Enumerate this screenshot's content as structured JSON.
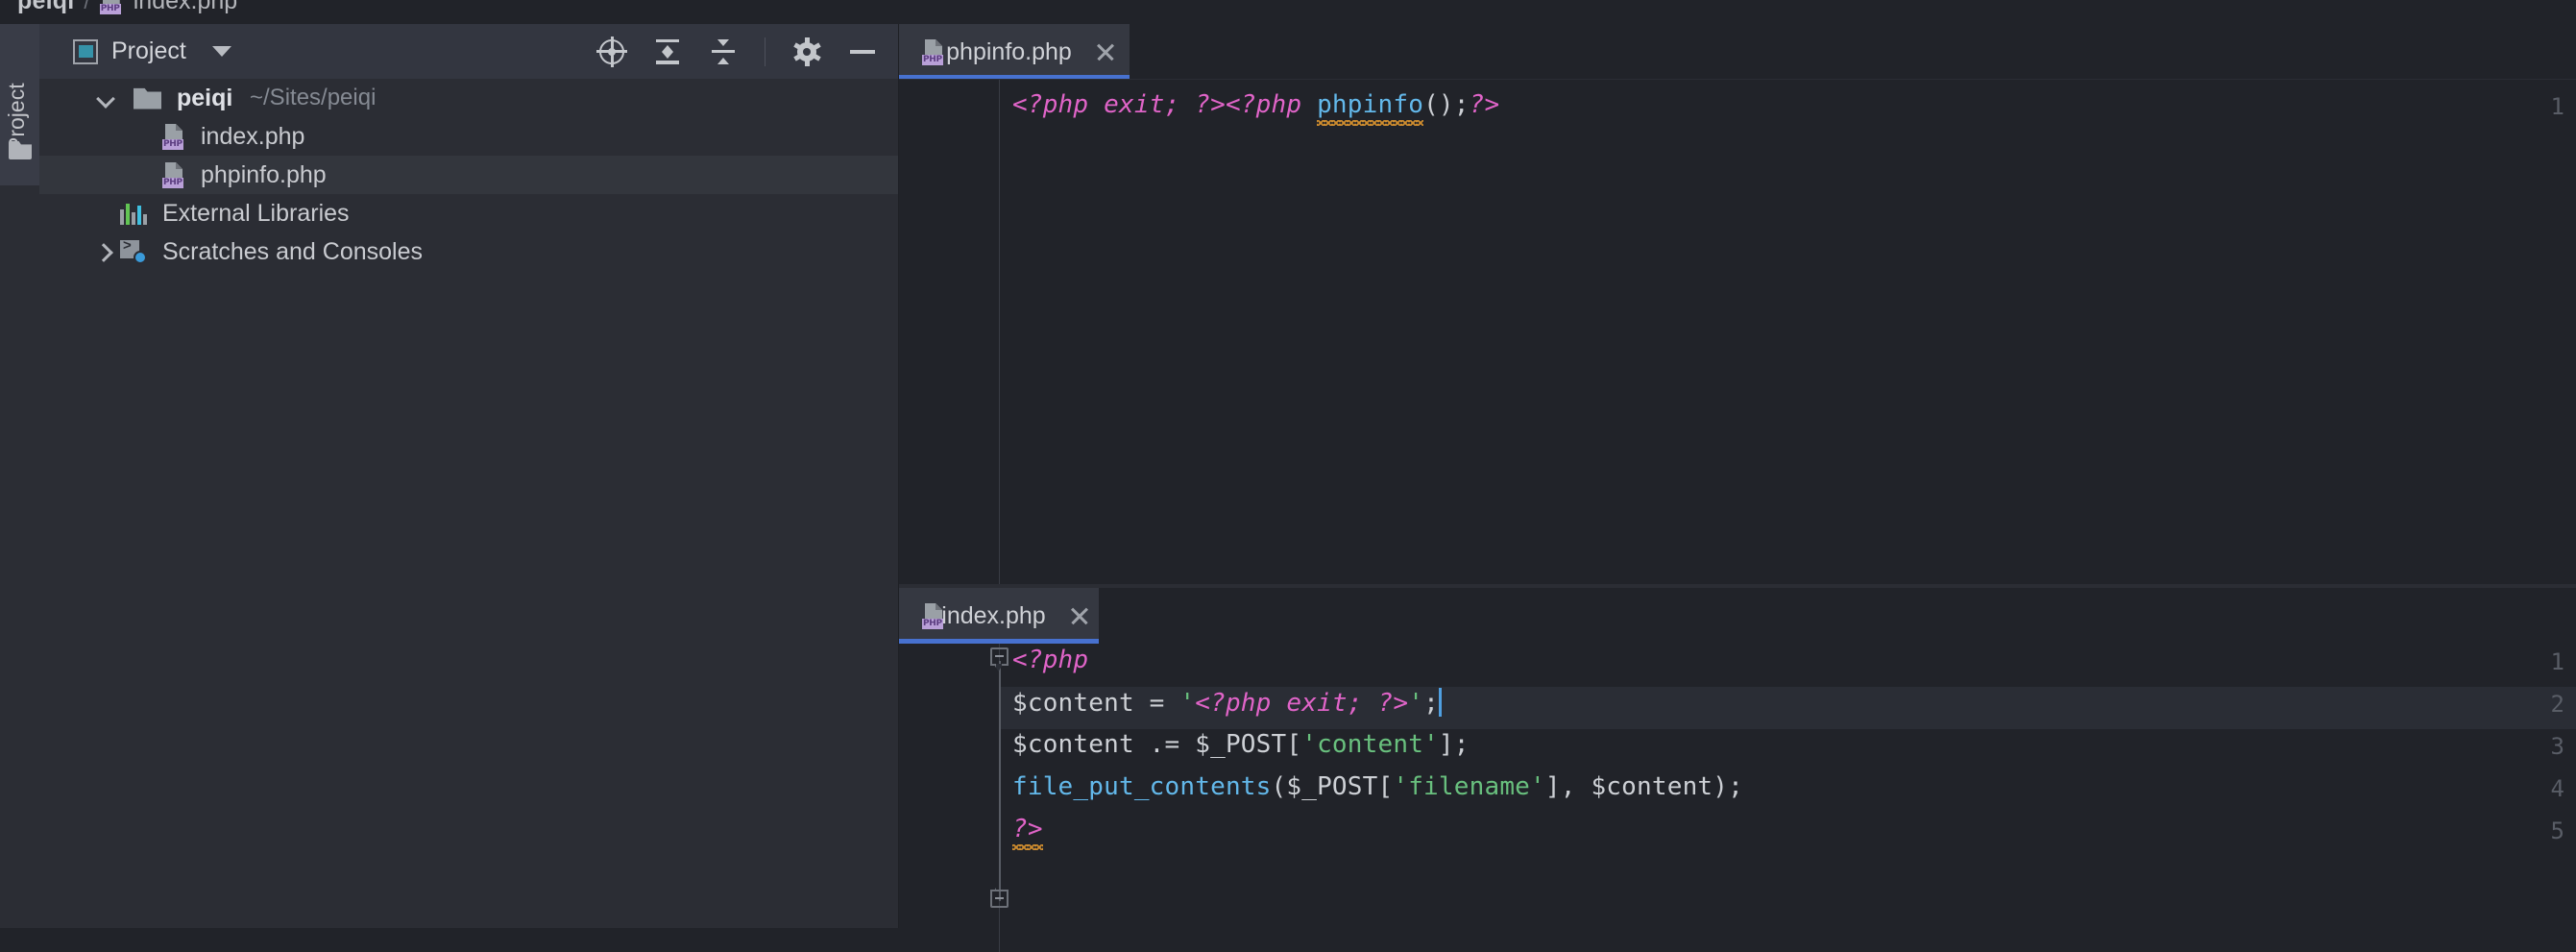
{
  "breadcrumb": {
    "project": "peiqi",
    "separator": "/",
    "file": "index.php",
    "file_icon": "php-file-icon"
  },
  "side_tool_strip": {
    "tab_label": "Project",
    "folder_icon": "folder-icon"
  },
  "project_panel": {
    "title": "Project",
    "panel_icon": "project-view-icon",
    "dropdown_icon": "chevron-down-icon",
    "toolbar": [
      {
        "name": "locate-in-tree-button",
        "icon": "target-icon"
      },
      {
        "name": "expand-all-button",
        "icon": "expand-all-icon"
      },
      {
        "name": "collapse-all-button",
        "icon": "collapse-all-icon"
      },
      {
        "name": "panel-settings-button",
        "icon": "gear-icon"
      },
      {
        "name": "hide-panel-button",
        "icon": "minimize-icon"
      }
    ],
    "tree": [
      {
        "label": "peiqi",
        "secondary": "~/Sites/peiqi",
        "icon": "folder-icon",
        "expander": "chevron-down-icon",
        "indent": 58,
        "bold": true,
        "selected": false
      },
      {
        "label": "index.php",
        "secondary": "",
        "icon": "php-file-icon",
        "expander": "",
        "indent": 122,
        "bold": false,
        "selected": false
      },
      {
        "label": "phpinfo.php",
        "secondary": "",
        "icon": "php-file-icon",
        "expander": "",
        "indent": 122,
        "bold": false,
        "selected": true
      },
      {
        "label": "External Libraries",
        "secondary": "",
        "icon": "library-icon",
        "expander": "",
        "indent": 83,
        "bold": false,
        "selected": false
      },
      {
        "label": "Scratches and Consoles",
        "secondary": "",
        "icon": "scratches-icon",
        "expander": "chevron-right-icon",
        "indent": 83,
        "bold": false,
        "selected": false
      }
    ]
  },
  "editors": {
    "top": {
      "tab": {
        "label": "phpinfo.php",
        "icon": "php-file-icon",
        "close_icon": "close-icon",
        "active": true
      },
      "lines": [
        {
          "number": "1",
          "tokens": [
            {
              "text": "<?php exit; ?><?php ",
              "type": "tag"
            },
            {
              "text": "phpinfo",
              "type": "func-squiggle"
            },
            {
              "text": "();",
              "type": "plain"
            },
            {
              "text": "?>",
              "type": "tag"
            }
          ]
        }
      ]
    },
    "bottom": {
      "tab": {
        "label": "index.php",
        "icon": "php-file-icon",
        "close_icon": "close-icon",
        "active": true
      },
      "lines": [
        {
          "number": "1",
          "fold": "fold-start",
          "tokens": [
            {
              "text": "<?php",
              "type": "tag"
            }
          ]
        },
        {
          "number": "2",
          "current": true,
          "tokens": [
            {
              "text": "$content = ",
              "type": "plain"
            },
            {
              "text": "'",
              "type": "str"
            },
            {
              "text": "<?php exit; ?>",
              "type": "tag-in-string"
            },
            {
              "text": "'",
              "type": "str"
            },
            {
              "text": ";",
              "type": "plain"
            },
            {
              "text": "",
              "type": "caret"
            }
          ]
        },
        {
          "number": "3",
          "tokens": [
            {
              "text": "$content .= $_POST[",
              "type": "plain"
            },
            {
              "text": "'content'",
              "type": "str"
            },
            {
              "text": "];",
              "type": "plain"
            }
          ]
        },
        {
          "number": "4",
          "tokens": [
            {
              "text": "file_put_contents",
              "type": "func"
            },
            {
              "text": "($_POST[",
              "type": "plain"
            },
            {
              "text": "'filename'",
              "type": "str"
            },
            {
              "text": "], $content);",
              "type": "plain"
            }
          ]
        },
        {
          "number": "5",
          "fold": "fold-end",
          "tokens": [
            {
              "text": "?>",
              "type": "tag-squiggle"
            }
          ]
        }
      ]
    }
  },
  "colors": {
    "background": "#212329",
    "panel": "#2b2d34",
    "panel_header": "#333640",
    "tab_active": "#353841",
    "tab_underline": "#4771cf",
    "php_tag": "#e064c8",
    "function": "#63b8ea",
    "string": "#69c07e",
    "plain_text": "#cdd0d5",
    "error_squiggle": "#d8922f",
    "caret": "#4f9fe0",
    "selection": "#33363d"
  }
}
